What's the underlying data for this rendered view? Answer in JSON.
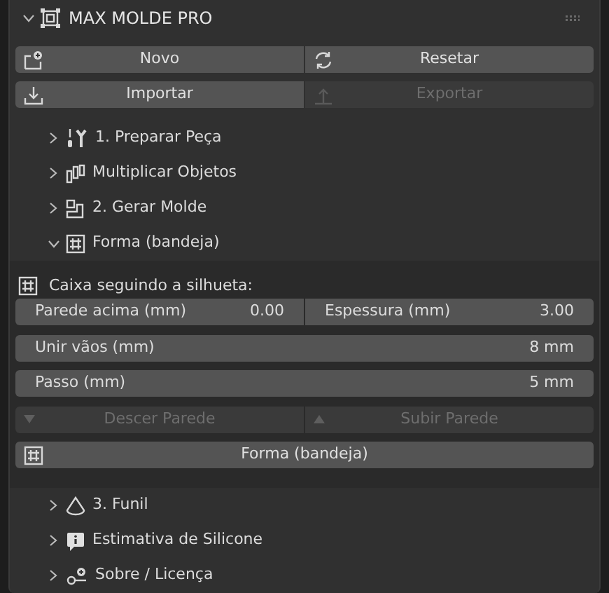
{
  "panel": {
    "title": "MAX MOLDE PRO",
    "expanded": true
  },
  "buttons": [
    [
      {
        "label": "Novo",
        "kind": "new",
        "disabled": false
      },
      {
        "label": "Resetar",
        "kind": "reset",
        "disabled": false
      }
    ],
    [
      {
        "label": "Importar",
        "kind": "import",
        "disabled": false
      },
      {
        "label": "Exportar",
        "kind": "export",
        "disabled": true
      }
    ]
  ],
  "subpanels": [
    {
      "label": "1. Preparar Peça",
      "kind": "tools",
      "expanded": false
    },
    {
      "label": "Multiplicar Objetos",
      "kind": "bars",
      "expanded": false
    },
    {
      "label": "2. Gerar Molde",
      "kind": "mold",
      "expanded": false
    },
    {
      "label": "Forma (bandeja)",
      "kind": "grid",
      "expanded": true,
      "body": {
        "heading": "Caixa seguindo a silhueta:",
        "fields": [
          [
            {
              "label": "Parede acima (mm)",
              "value": "0.00"
            },
            {
              "label": "Espessura (mm)",
              "value": "3.00"
            }
          ],
          [
            {
              "label": "Unir vãos (mm)",
              "value": "8 mm"
            }
          ],
          [
            {
              "label": "Passo (mm)",
              "value": "5 mm"
            }
          ]
        ],
        "buttons": [
          [
            {
              "label": "Descer Parede",
              "kind": "down",
              "disabled": true
            },
            {
              "label": "Subir Parede",
              "kind": "up",
              "disabled": true
            }
          ],
          [
            {
              "label": "Forma (bandeja)",
              "kind": "grid",
              "disabled": false
            }
          ]
        ]
      }
    },
    {
      "label": "3. Funil",
      "kind": "cone",
      "expanded": false
    },
    {
      "label": "Estimativa de Silicone",
      "kind": "info",
      "expanded": false
    },
    {
      "label": "Sobre / Licença",
      "kind": "key",
      "expanded": false
    }
  ]
}
